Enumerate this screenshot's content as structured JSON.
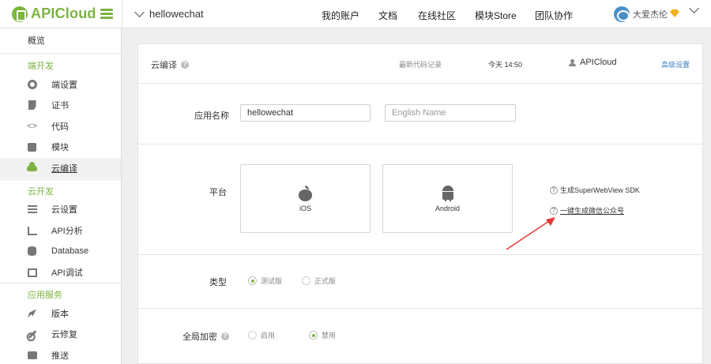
{
  "header": {
    "logo_text": "APICloud",
    "project_name": "hellowechat",
    "nav": [
      "我的账户",
      "文档",
      "在线社区",
      "模块Store",
      "团队协作"
    ],
    "user_name": "大爱杰伦"
  },
  "sidebar": {
    "overview": "概览",
    "sections": {
      "client": "端开发",
      "cloud": "云开发",
      "services": "应用服务"
    },
    "items": [
      {
        "label": "端设置",
        "icon": "gear-icon"
      },
      {
        "label": "证书",
        "icon": "document-icon"
      },
      {
        "label": "代码",
        "icon": "code-icon"
      },
      {
        "label": "模块",
        "icon": "puzzle-icon"
      },
      {
        "label": "云编译",
        "icon": "cloud-icon"
      },
      {
        "label": "云设置",
        "icon": "sliders-icon"
      },
      {
        "label": "API分析",
        "icon": "chart-icon"
      },
      {
        "label": "Database",
        "icon": "database-icon"
      },
      {
        "label": "API调试",
        "icon": "api-icon"
      },
      {
        "label": "版本",
        "icon": "rocket-icon"
      },
      {
        "label": "云修复",
        "icon": "wrench-icon"
      },
      {
        "label": "推送",
        "icon": "push-icon"
      }
    ],
    "active_index": 4,
    "code_glyph": "<>"
  },
  "main": {
    "title": "云编译",
    "latest_code_label": "最新代码记录",
    "latest_time": "今天 14:50",
    "latest_user": "APICloud",
    "advanced_link": "高级设置",
    "app_name": {
      "label": "应用名称",
      "value": "hellowechat",
      "english_placeholder": "English Name"
    },
    "platform": {
      "label": "平台",
      "options": [
        "iOS",
        "Android"
      ],
      "links": [
        "生成SuperWebView SDK",
        "一键生成微信公众号"
      ]
    },
    "type": {
      "label": "类型",
      "options": [
        "测试版",
        "正式版"
      ],
      "selected": "测试版"
    },
    "encryption": {
      "label": "全局加密",
      "options": [
        "启用",
        "禁用"
      ],
      "selected": "禁用"
    },
    "help_glyph": "?"
  },
  "colors": {
    "brand_green": "#7cb342",
    "link_blue": "#3c7ec2",
    "annotation_red": "#e53935"
  }
}
